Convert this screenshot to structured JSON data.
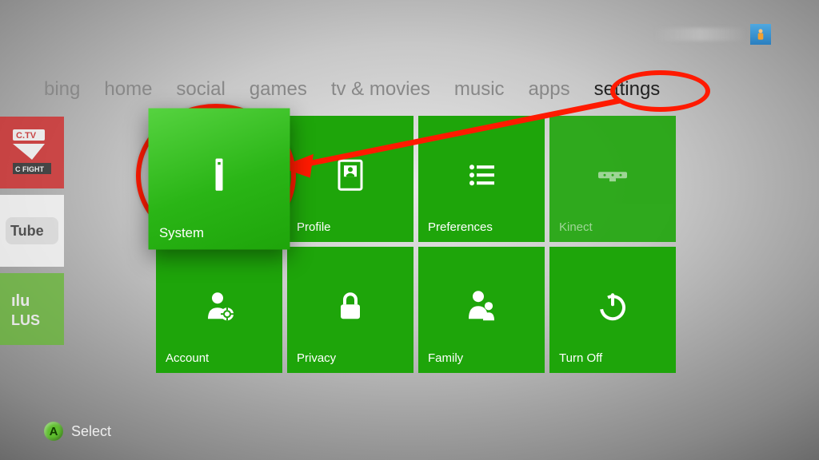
{
  "user": {
    "blurred": true
  },
  "nav": {
    "items": [
      {
        "label": "bing",
        "active": false
      },
      {
        "label": "home",
        "active": false
      },
      {
        "label": "social",
        "active": false
      },
      {
        "label": "games",
        "active": false
      },
      {
        "label": "tv & movies",
        "active": false
      },
      {
        "label": "music",
        "active": false
      },
      {
        "label": "apps",
        "active": false
      },
      {
        "label": "settings",
        "active": true
      }
    ]
  },
  "side_apps": [
    {
      "name": "UFC",
      "style": "ufc"
    },
    {
      "name": "YouTube",
      "style": "youtube"
    },
    {
      "name": "hulu PLUS",
      "style": "hulu"
    }
  ],
  "tiles": [
    {
      "label": "System",
      "icon": "console-icon",
      "focused": true,
      "disabled": false
    },
    {
      "label": "Profile",
      "icon": "profile-icon",
      "focused": false,
      "disabled": false
    },
    {
      "label": "Preferences",
      "icon": "preferences-icon",
      "focused": false,
      "disabled": false
    },
    {
      "label": "Kinect",
      "icon": "kinect-icon",
      "focused": false,
      "disabled": true
    },
    {
      "label": "Account",
      "icon": "account-icon",
      "focused": false,
      "disabled": false
    },
    {
      "label": "Privacy",
      "icon": "privacy-icon",
      "focused": false,
      "disabled": false
    },
    {
      "label": "Family",
      "icon": "family-icon",
      "focused": false,
      "disabled": false
    },
    {
      "label": "Turn Off",
      "icon": "power-icon",
      "focused": false,
      "disabled": false
    }
  ],
  "hint": {
    "button": "A",
    "label": "Select"
  },
  "colors": {
    "tile_green": "#1ea50a",
    "annotation_red": "#ff1a00"
  },
  "annotation": {
    "targets": [
      "nav-item-settings",
      "tile-system"
    ],
    "arrow_from": "nav-item-settings",
    "arrow_to": "tile-system"
  }
}
